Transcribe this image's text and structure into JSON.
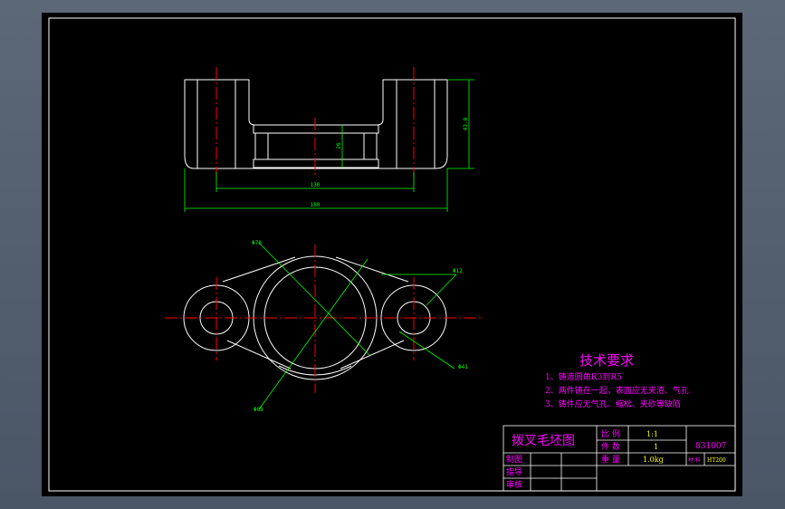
{
  "drawing": {
    "dimensions": {
      "overall_width": "180",
      "inner_width": "130",
      "height": "43.8",
      "inner_height": "26",
      "dia_large": "Φ70",
      "dia_small_left": "Φ12",
      "dia_small_right": "Φ41",
      "dia_bottom": "Φ88"
    },
    "tech_requirements": {
      "title": "技术要求",
      "items": [
        "1、铸造圆角R3到R5",
        "2、两件铸在一起，表面应无夹渣、气孔",
        "3、铸件应无气孔、缩松、夹砂等缺陷"
      ]
    },
    "title_block": {
      "part_name": "拨叉毛坯图",
      "scale_label": "比 例",
      "scale_value": "1:1",
      "qty_label": "件 数",
      "qty_value": "1",
      "weight_label": "重 量",
      "weight_value": "1.0kg",
      "drawing_no": "831007",
      "material_label": "材 料",
      "material_value": "HT200",
      "drawn_label": "制图",
      "guide_label": "指导",
      "review_label": "审核"
    }
  },
  "colors": {
    "background": "#000000",
    "outline": "#ffffff",
    "centerline": "#ff0000",
    "dimension": "#00ff00",
    "text_magenta": "#ff00ff",
    "text_yellow": "#ffff00",
    "frame_bg": "#5c6878"
  }
}
